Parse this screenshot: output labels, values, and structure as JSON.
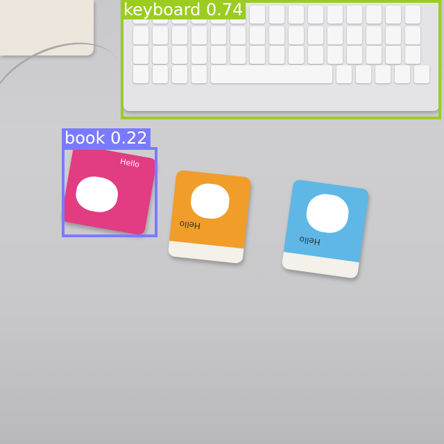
{
  "detections": [
    {
      "label": "keyboard 0.74",
      "color": "#9bcc21"
    },
    {
      "label": "book 0.22",
      "color": "#7a7aff"
    }
  ],
  "packs": [
    {
      "text": "Hello",
      "color": "#e23c83"
    },
    {
      "text": "Hello",
      "color": "#f09d2a"
    },
    {
      "text": "Hello",
      "color": "#5fb7e6"
    }
  ]
}
